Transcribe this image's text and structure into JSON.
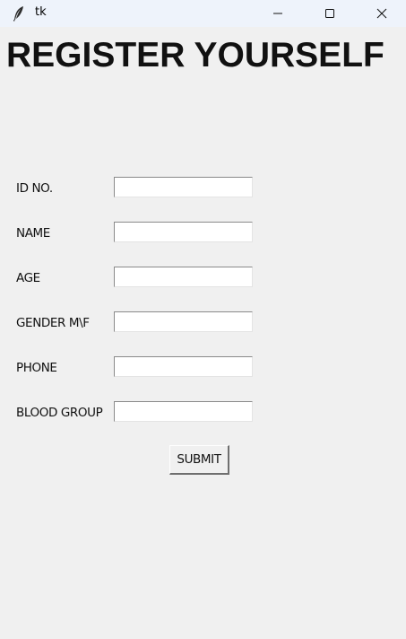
{
  "window": {
    "title": "tk"
  },
  "form": {
    "heading": "REGISTER YOURSELF",
    "fields": [
      {
        "label": "ID  NO.",
        "value": ""
      },
      {
        "label": "NAME",
        "value": ""
      },
      {
        "label": "AGE",
        "value": ""
      },
      {
        "label": "GENDER M\\F",
        "value": ""
      },
      {
        "label": "PHONE",
        "value": ""
      },
      {
        "label": "BLOOD GROUP",
        "value": ""
      }
    ],
    "submit_label": "SUBMIT"
  },
  "icons": {
    "app": "feather-icon",
    "minimize": "minimize-icon",
    "maximize": "maximize-icon",
    "close": "close-icon"
  }
}
